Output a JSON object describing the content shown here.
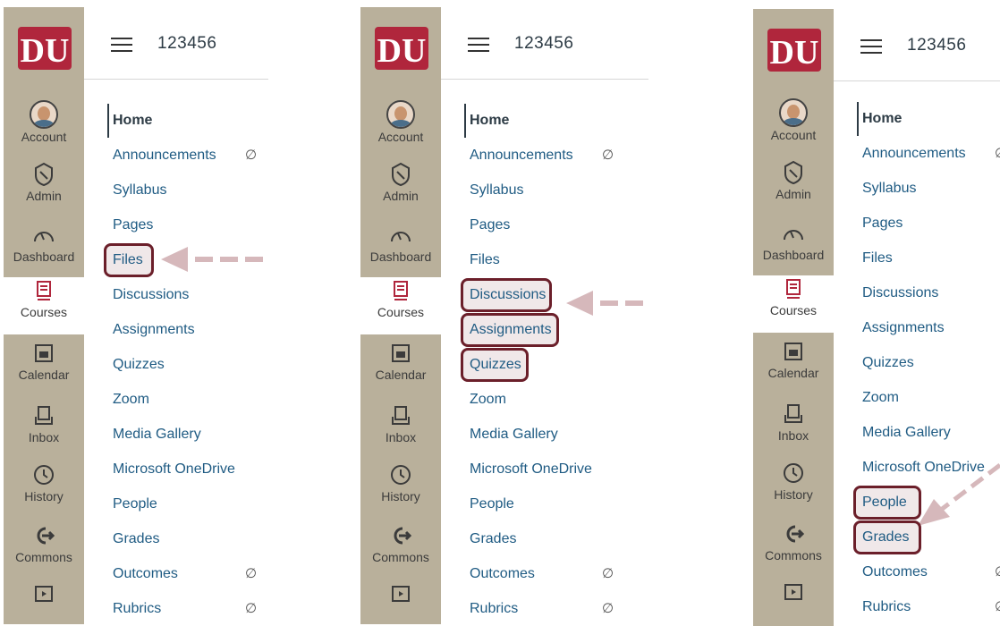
{
  "header": {
    "course_code": "123456"
  },
  "global_nav": [
    {
      "key": "account",
      "label": "Account"
    },
    {
      "key": "admin",
      "label": "Admin"
    },
    {
      "key": "dashboard",
      "label": "Dashboard"
    },
    {
      "key": "courses",
      "label": "Courses"
    },
    {
      "key": "calendar",
      "label": "Calendar"
    },
    {
      "key": "inbox",
      "label": "Inbox"
    },
    {
      "key": "history",
      "label": "History"
    },
    {
      "key": "commons",
      "label": "Commons"
    }
  ],
  "course_nav": [
    {
      "label": "Home"
    },
    {
      "label": "Announcements",
      "hidden": true
    },
    {
      "label": "Syllabus"
    },
    {
      "label": "Pages"
    },
    {
      "label": "Files"
    },
    {
      "label": "Discussions"
    },
    {
      "label": "Assignments"
    },
    {
      "label": "Quizzes"
    },
    {
      "label": "Zoom"
    },
    {
      "label": "Media Gallery"
    },
    {
      "label": "Microsoft OneDrive"
    },
    {
      "label": "People"
    },
    {
      "label": "Grades"
    },
    {
      "label": "Outcomes",
      "hidden": true
    },
    {
      "label": "Rubrics",
      "hidden": true
    }
  ],
  "highlights": {
    "panel_1": [
      "Files"
    ],
    "panel_2": [
      "Discussions",
      "Assignments",
      "Quizzes"
    ],
    "panel_3": [
      "People",
      "Grades"
    ]
  },
  "colors": {
    "nav_bg": "#b9b09b",
    "brand": "#b0263c",
    "link": "#1f5b83",
    "highlight": "#6b1f2a",
    "arrow": "#d6b8bb"
  },
  "icons": {
    "hidden": "eye-slash-icon"
  }
}
